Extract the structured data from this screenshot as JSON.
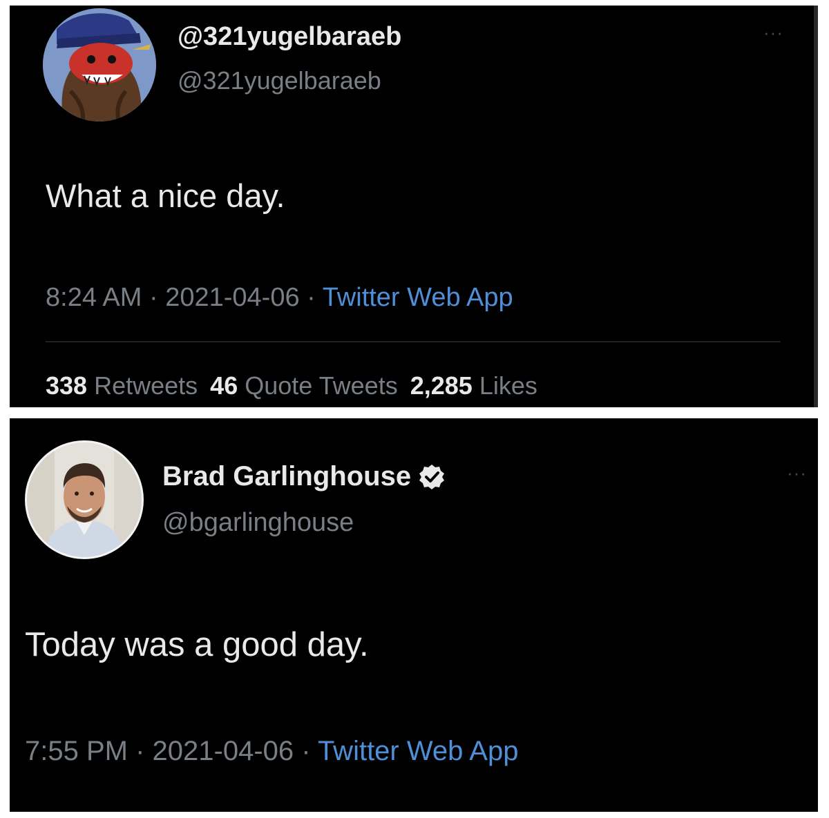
{
  "tweet1": {
    "display_name": "@321yugelbaraeb",
    "handle": "@321yugelbaraeb",
    "text": "What a nice day.",
    "time": "8:24 AM",
    "separator": " · ",
    "date": "2021-04-06",
    "source": "Twitter Web App",
    "more": "···",
    "stats": {
      "retweets_count": "338",
      "retweets_label": "Retweets",
      "quotes_count": "46",
      "quotes_label": "Quote Tweets",
      "likes_count": "2,285",
      "likes_label": "Likes"
    }
  },
  "tweet2": {
    "display_name": "Brad Garlinghouse",
    "handle": "@bgarlinghouse",
    "text": "Today was a good day.",
    "time": "7:55 PM",
    "separator": " · ",
    "date": "2021-04-06",
    "source": "Twitter Web App",
    "more": "···"
  },
  "colors": {
    "background": "#000000",
    "text_primary": "#e9e9e9",
    "text_secondary": "#7a7f85",
    "link": "#4f8fd8"
  }
}
